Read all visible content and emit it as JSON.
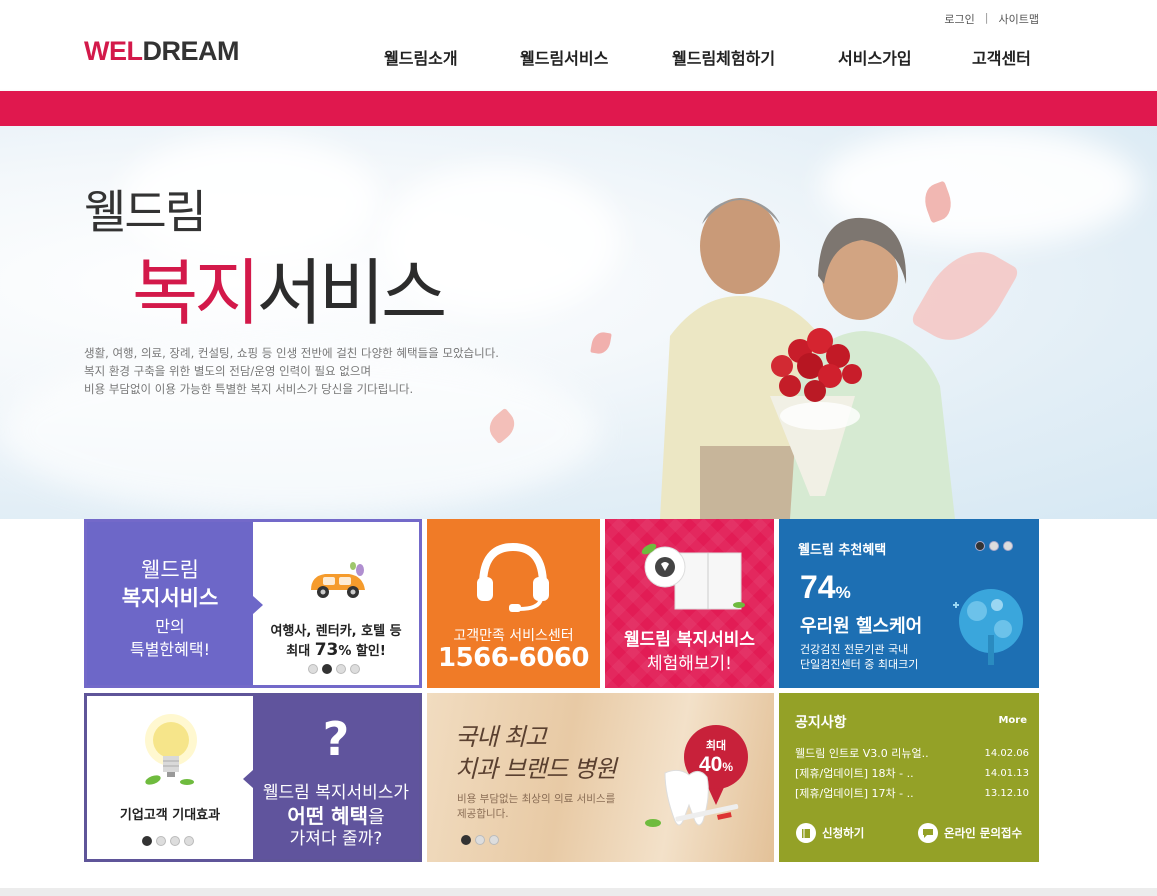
{
  "header": {
    "logo_part1": "WEL",
    "logo_part2": "DREAM",
    "util": {
      "login": "로그인",
      "sitemap": "사이트맵"
    },
    "nav": [
      "웰드림소개",
      "웰드림서비스",
      "웰드림체험하기",
      "서비스가입",
      "고객센터"
    ]
  },
  "hero": {
    "title1": "웰드림",
    "title2_accent": "복지",
    "title2_rest": "서비스",
    "desc": [
      "생활, 여행, 의료, 장례, 컨설팅, 쇼핑 등 인생 전반에 걸친 다양한 혜택들을 모았습니다.",
      "복지 환경 구축을 위한 별도의 전담/운영 인력이 필요 없으며",
      "비용 부담없이 이용 가능한 특별한 복지 서비스가 당신을 기다립니다."
    ]
  },
  "tile_benefit": {
    "l1": "웰드림",
    "l2": "복지서비스",
    "l3": "만의",
    "l4": "특별한혜택!",
    "r1": "여행사, 렌터카, 호텔 등",
    "r2_pre": "최대 ",
    "r2_big": "73",
    "r2_post": "% 할인!"
  },
  "tile_cs": {
    "label": "고객만족 서비스센터",
    "phone": "1566-6060"
  },
  "tile_trial": {
    "l1": "웰드림 복지서비스",
    "l2": "체험해보기!"
  },
  "tile_recommend": {
    "heading": "웰드림 추천혜택",
    "pct": "74",
    "pct_unit": "%",
    "name": "우리원 헬스케어",
    "s1": "건강검진 전문기관 국내",
    "s2": "단일검진센터 중 최대크기"
  },
  "tile_effect": {
    "label": "기업고객 기대효과",
    "q": "?",
    "r1": "웰드림 복지서비스가",
    "r2_bold": "어떤 혜택",
    "r2_rest": "을",
    "r3": "가져다 줄까?"
  },
  "tile_dental": {
    "hw1": "국내 최고",
    "hw2": "치과 브랜드 병원",
    "d1": "비용 부담없는 최상의 의료 서비스를",
    "d2": "제공합니다.",
    "badge_top": "최대",
    "badge_num": "40",
    "badge_unit": "%"
  },
  "notice": {
    "heading": "공지사항",
    "more": "More",
    "items": [
      {
        "title": "웰드림 인트로 V3.0 리뉴얼..",
        "date": "14.02.06"
      },
      {
        "title": "[제휴/업데이트] 18차 - ..",
        "date": "14.01.13"
      },
      {
        "title": "[제휴/업데이트] 17차 - ..",
        "date": "13.12.10"
      }
    ],
    "apply": "신청하기",
    "inquiry": "온라인 문의접수"
  },
  "colors": {
    "brand_red": "#e0184e",
    "purple": "#6d67c8",
    "orange": "#f07b27",
    "pink": "#e21c55",
    "blue": "#1d6fb3",
    "olive": "#94a127"
  }
}
